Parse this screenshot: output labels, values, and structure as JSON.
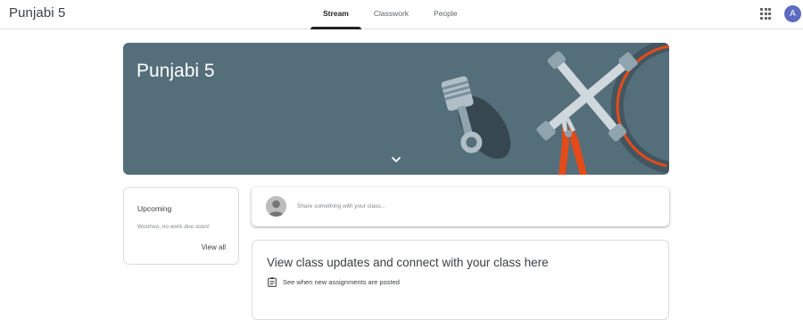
{
  "header": {
    "class_title": "Punjabi 5",
    "tabs": [
      {
        "label": "Stream",
        "active": true
      },
      {
        "label": "Classwork",
        "active": false
      },
      {
        "label": "People",
        "active": false
      }
    ],
    "apps_icon": "apps-grid-icon",
    "account_initial": "A"
  },
  "banner": {
    "title": "Punjabi 5",
    "background_color": "#546e7a",
    "illustration": "tools-illustration",
    "expand_icon": "chevron-down-icon"
  },
  "upcoming": {
    "title": "Upcoming",
    "text": "Woohoo, no work due soon!",
    "link": "View all"
  },
  "share": {
    "placeholder": "Share something with your class..."
  },
  "updates": {
    "title": "View class updates and connect with your class here",
    "items": [
      {
        "icon": "assignment-icon",
        "text": "See when new assignments are posted"
      }
    ]
  },
  "colors": {
    "accent": "#202124",
    "banner": "#546e7a",
    "avatar": "#5c6bc0",
    "illustration_orange": "#e64a19"
  }
}
